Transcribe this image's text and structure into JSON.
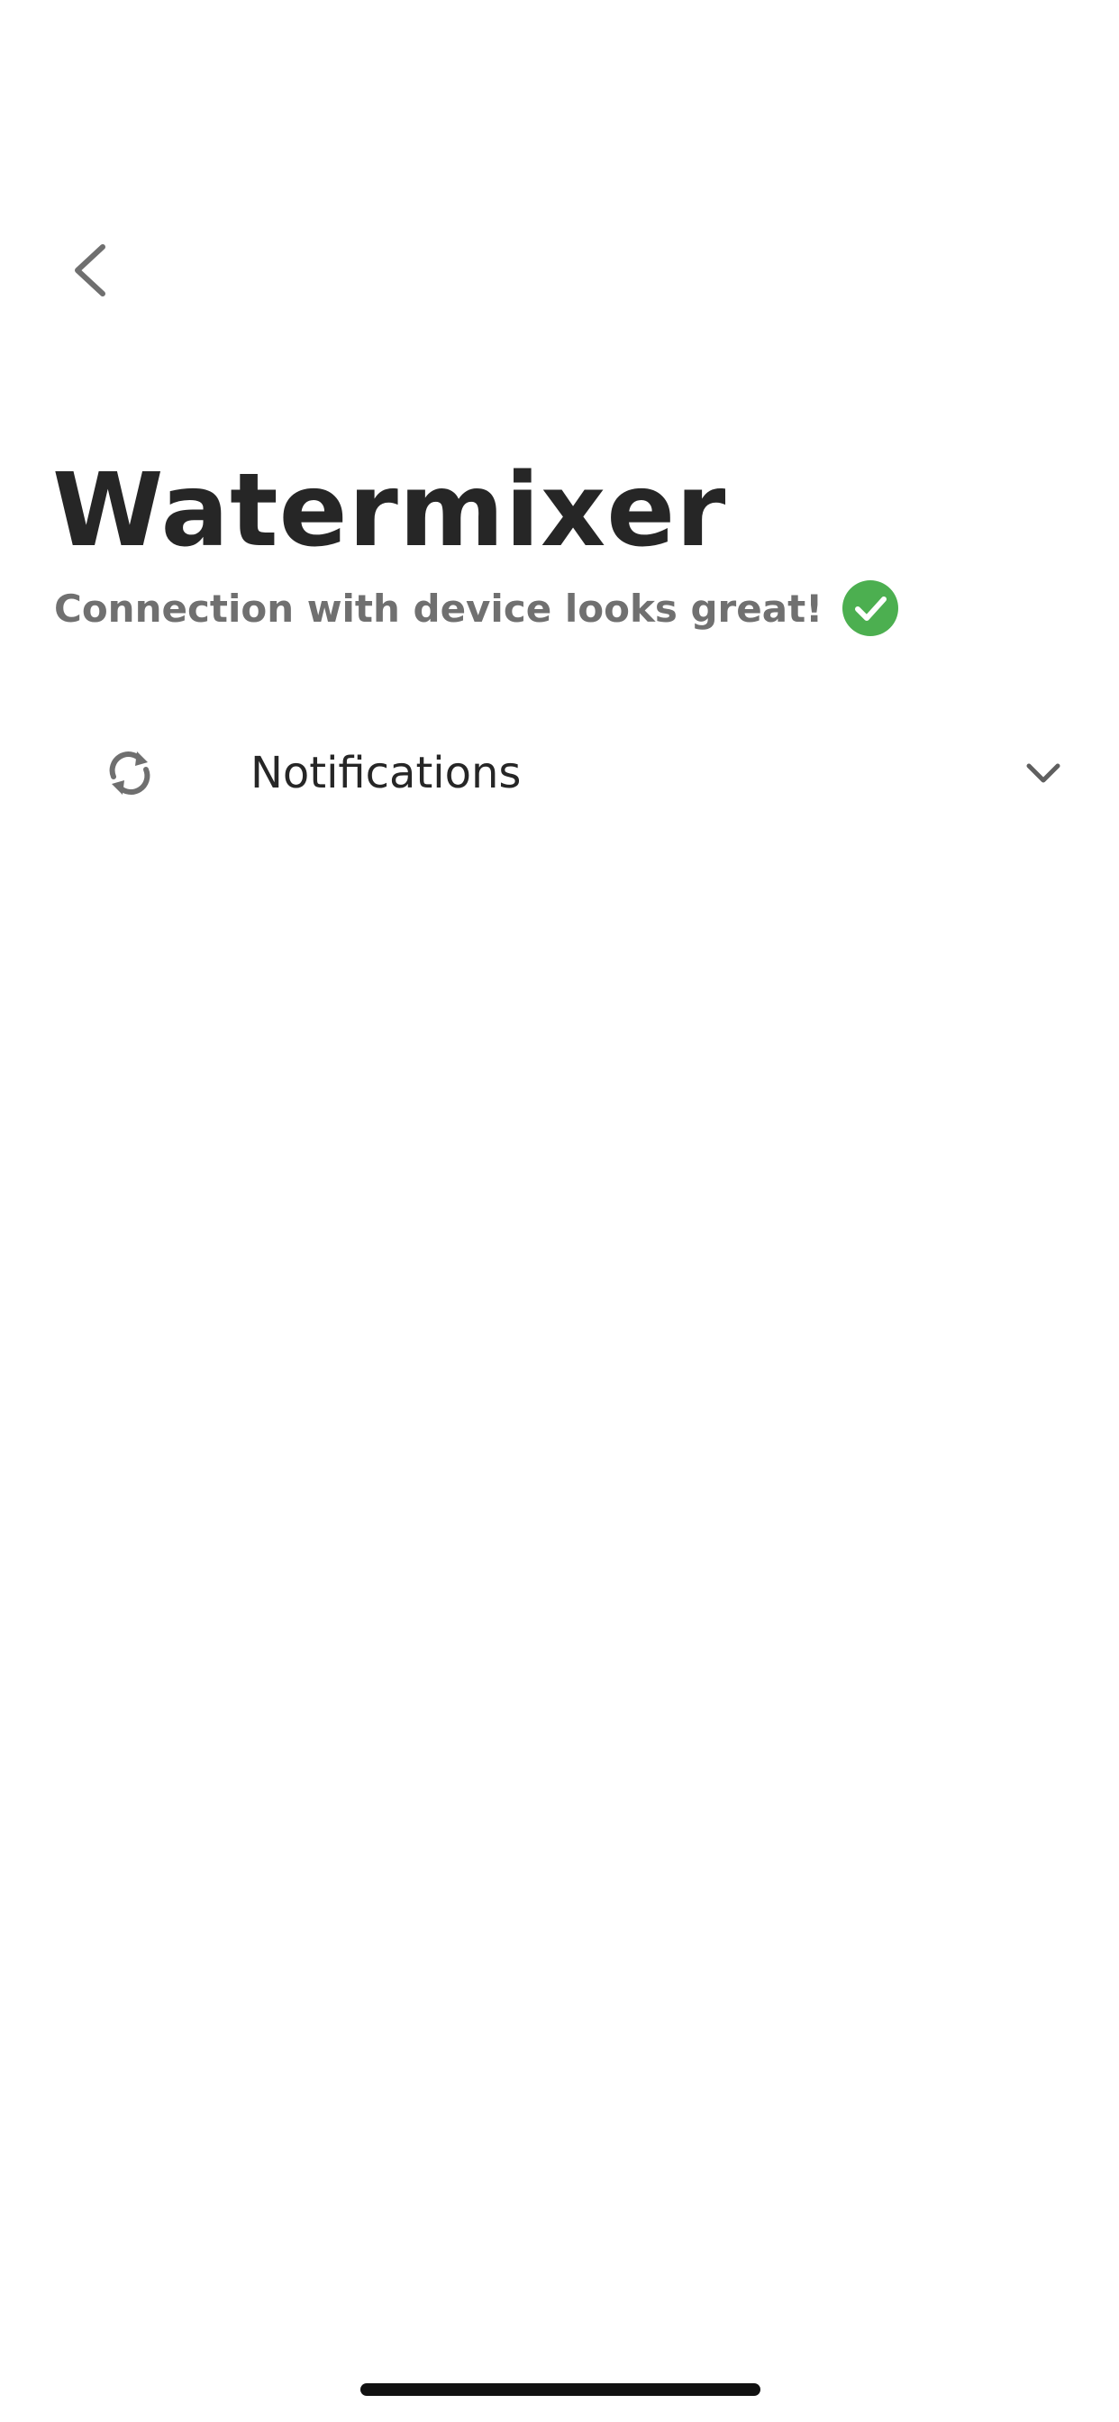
{
  "header": {
    "back_icon": "chevron-left-icon"
  },
  "page": {
    "title": "Watermixer",
    "status_text": "Connection with device looks great!",
    "status_icon": "check-circle-icon",
    "status_color": "#4CAF50"
  },
  "sections": [
    {
      "icon": "sync-icon",
      "label": "Notifications",
      "expand_icon": "chevron-down-icon",
      "expanded": false
    }
  ],
  "colors": {
    "text_primary": "#262626",
    "text_secondary": "#707070",
    "icon": "#6f6f6f",
    "success": "#4CAF50"
  }
}
